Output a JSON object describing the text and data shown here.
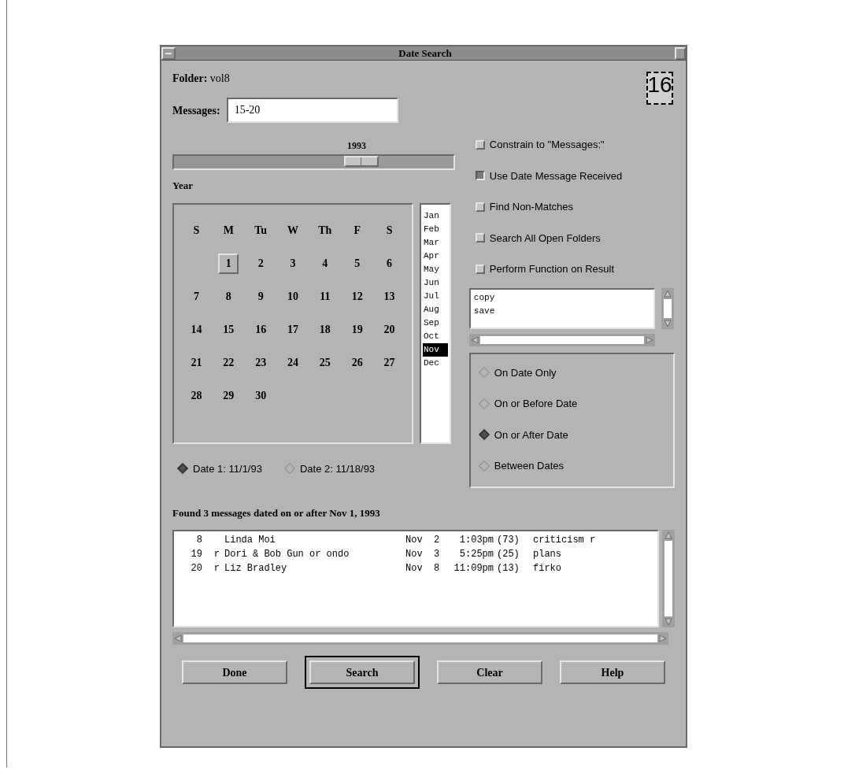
{
  "window": {
    "title": "Date Search"
  },
  "folder": {
    "label": "Folder:",
    "value": "vol8"
  },
  "messages_field": {
    "label": "Messages:",
    "value": "15-20"
  },
  "calendar_icon": {
    "day": "16"
  },
  "year_slider": {
    "reading": "1993",
    "label": "Year",
    "level": 0.67
  },
  "weekdays": [
    "S",
    "M",
    "Tu",
    "W",
    "Th",
    "F",
    "S"
  ],
  "days": [
    {
      "label": "1",
      "selected": true
    },
    {
      "label": "2",
      "selected": false
    },
    {
      "label": "3",
      "selected": false
    },
    {
      "label": "4",
      "selected": false
    },
    {
      "label": "5",
      "selected": false
    },
    {
      "label": "6",
      "selected": false
    },
    {
      "label": "7",
      "selected": false
    },
    {
      "label": "8",
      "selected": false
    },
    {
      "label": "9",
      "selected": false
    },
    {
      "label": "10",
      "selected": false
    },
    {
      "label": "11",
      "selected": false
    },
    {
      "label": "12",
      "selected": false
    },
    {
      "label": "13",
      "selected": false
    },
    {
      "label": "14",
      "selected": false
    },
    {
      "label": "15",
      "selected": false
    },
    {
      "label": "16",
      "selected": false
    },
    {
      "label": "17",
      "selected": false
    },
    {
      "label": "18",
      "selected": false
    },
    {
      "label": "19",
      "selected": false
    },
    {
      "label": "20",
      "selected": false
    },
    {
      "label": "21",
      "selected": false
    },
    {
      "label": "22",
      "selected": false
    },
    {
      "label": "23",
      "selected": false
    },
    {
      "label": "24",
      "selected": false
    },
    {
      "label": "25",
      "selected": false
    },
    {
      "label": "26",
      "selected": false
    },
    {
      "label": "27",
      "selected": false
    },
    {
      "label": "28",
      "selected": false
    },
    {
      "label": "29",
      "selected": false
    },
    {
      "label": "30",
      "selected": false
    }
  ],
  "months": [
    {
      "label": "Jan",
      "selected": false
    },
    {
      "label": "Feb",
      "selected": false
    },
    {
      "label": "Mar",
      "selected": false
    },
    {
      "label": "Apr",
      "selected": false
    },
    {
      "label": "May",
      "selected": false
    },
    {
      "label": "Jun",
      "selected": false
    },
    {
      "label": "Jul",
      "selected": false
    },
    {
      "label": "Aug",
      "selected": false
    },
    {
      "label": "Sep",
      "selected": false
    },
    {
      "label": "Oct",
      "selected": false
    },
    {
      "label": "Nov",
      "selected": true
    },
    {
      "label": "Dec",
      "selected": false
    }
  ],
  "date_radios": [
    {
      "label": "Date 1: 11/1/93",
      "selected": true
    },
    {
      "label": "Date 2: 11/18/93",
      "selected": false
    }
  ],
  "options": [
    {
      "label": "Constrain to \"Messages:\"",
      "checked": false
    },
    {
      "label": "Use Date Message Received",
      "checked": true
    },
    {
      "label": "Find Non-Matches",
      "checked": false
    },
    {
      "label": "Search All Open Folders",
      "checked": false
    },
    {
      "label": "Perform Function on Result",
      "checked": false
    }
  ],
  "functions": [
    "copy",
    "save"
  ],
  "match_modes": [
    {
      "label": "On Date Only",
      "selected": false
    },
    {
      "label": "On or Before Date",
      "selected": false
    },
    {
      "label": "On or After Date",
      "selected": true
    },
    {
      "label": "Between Dates",
      "selected": false
    }
  ],
  "result_summary": "Found 3 messages dated on or after Nov 1, 1993",
  "results": [
    {
      "number": "8",
      "from": "Linda Moi",
      "date": "Nov  2",
      "time": "1:03pm",
      "size": "(73)",
      "subject": "criticism r"
    },
    {
      "number": "19",
      "flag": "r",
      "from": "Dori & Bob Gun or ondo",
      "date": "Nov  3",
      "time": "5:25pm",
      "size": "(25)",
      "subject": "plans"
    },
    {
      "number": "20",
      "flag": "r",
      "from": "Liz Bradley",
      "date": "Nov  8",
      "time": "11:09pm",
      "size": "(13)",
      "subject": "firko"
    }
  ],
  "buttons": [
    {
      "label": "Done",
      "default": false
    },
    {
      "label": "Search",
      "default": true
    },
    {
      "label": "Clear",
      "default": false
    },
    {
      "label": "Help",
      "default": false
    }
  ]
}
